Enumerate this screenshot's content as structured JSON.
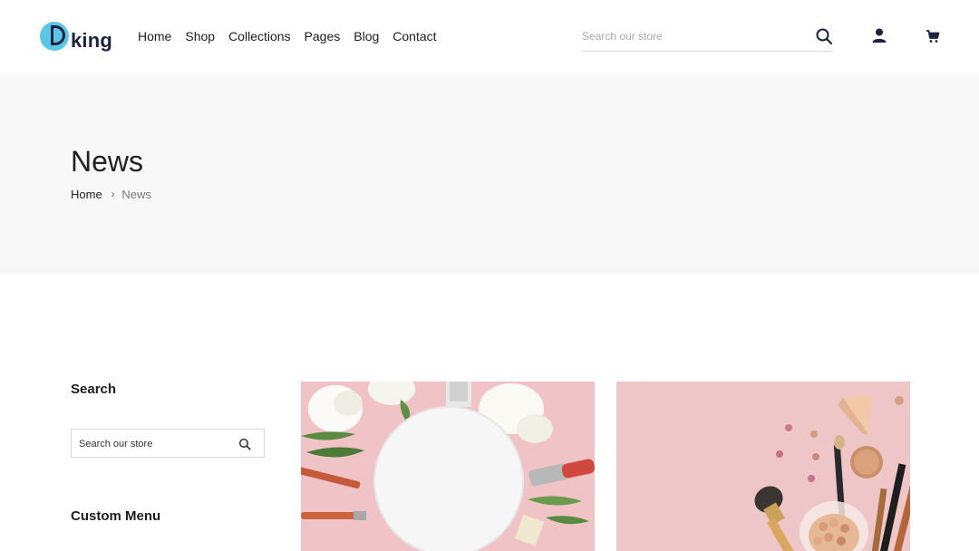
{
  "brand": {
    "logo_text": "king"
  },
  "nav": {
    "items": [
      {
        "label": "Home"
      },
      {
        "label": "Shop"
      },
      {
        "label": "Collections"
      },
      {
        "label": "Pages"
      },
      {
        "label": "Blog"
      },
      {
        "label": "Contact"
      }
    ]
  },
  "header": {
    "search_placeholder": "Search our store",
    "icons": [
      "search-icon",
      "user-icon",
      "cart-icon"
    ]
  },
  "page": {
    "title": "News",
    "breadcrumb": {
      "home": "Home",
      "separator": "›",
      "current": "News"
    }
  },
  "sidebar": {
    "search_heading": "Search",
    "search_placeholder": "Search our store",
    "menu_heading": "Custom Menu"
  },
  "colors": {
    "accent": "#5cc6e6",
    "brand_dark": "#1d2240",
    "band_bg": "#f8f8f8",
    "card_pink": "#f0c9cc"
  }
}
